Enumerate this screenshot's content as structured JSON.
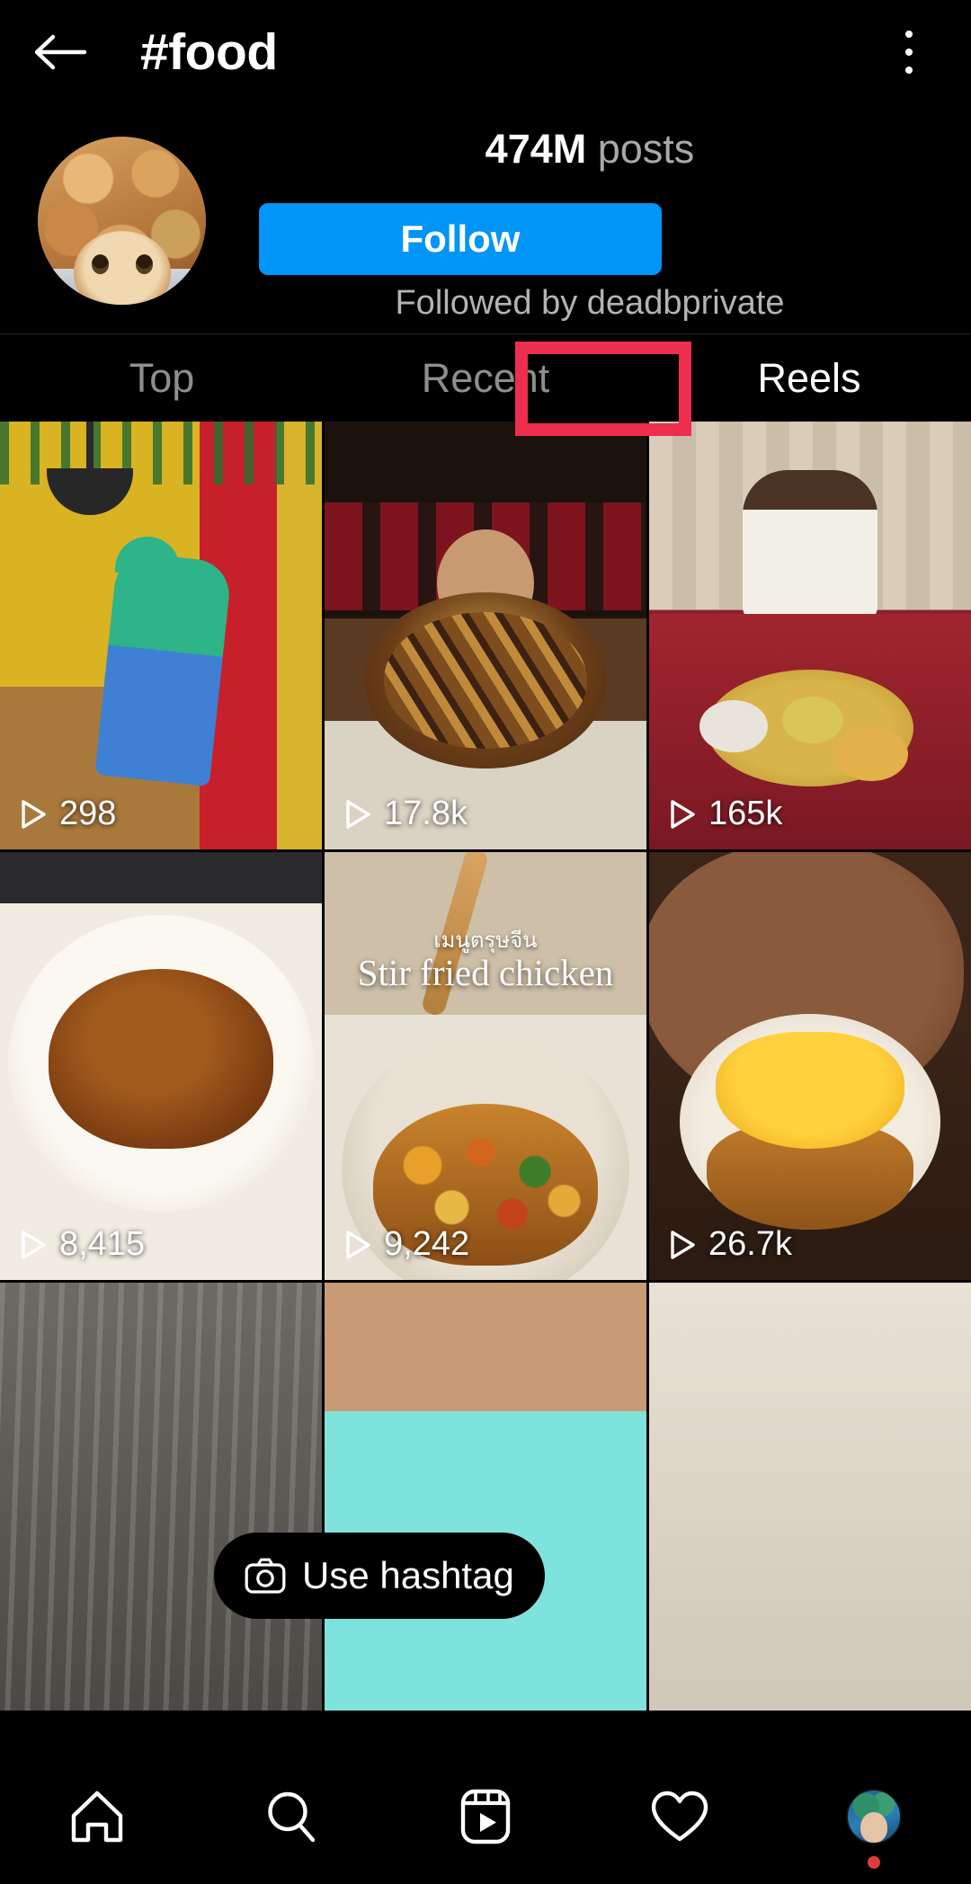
{
  "appbar": {
    "back_icon": "arrow-left-icon",
    "title": "#food",
    "menu_icon": "kebab-menu-icon"
  },
  "header": {
    "avatar_alt": "hashtag-avatar",
    "posts_number": "474M",
    "posts_label": " posts",
    "follow_label": "Follow",
    "followed_by": "Followed by deadbprivate"
  },
  "tabs": {
    "items": [
      {
        "label": "Top",
        "active": false
      },
      {
        "label": "Recent",
        "active": false
      },
      {
        "label": "Reels",
        "active": true
      }
    ],
    "highlight_color": "#ed2e4f"
  },
  "grid": {
    "tiles": [
      {
        "views": "298",
        "play_icon": "play-triangle-icon",
        "alt": "reel-cleaning-restaurant"
      },
      {
        "views": "17.8k",
        "play_icon": "play-triangle-icon",
        "alt": "reel-giant-meat-platter"
      },
      {
        "views": "165k",
        "play_icon": "play-triangle-icon",
        "alt": "reel-indian-thali"
      },
      {
        "views": "8,415",
        "play_icon": "play-triangle-icon",
        "alt": "reel-curry-bowl"
      },
      {
        "views": "9,242",
        "play_icon": "play-triangle-icon",
        "alt": "reel-stir-fried-chicken"
      },
      {
        "views": "26.7k",
        "play_icon": "play-triangle-icon",
        "alt": "reel-cheese-sandwich"
      }
    ],
    "partial_row": [
      {
        "alt": "reel-partial-1"
      },
      {
        "alt": "reel-partial-2"
      },
      {
        "alt": "reel-partial-3"
      }
    ],
    "captions": {
      "tile5_thai": "เมนูตรุษจีน",
      "tile5_english": "Stir fried chicken"
    }
  },
  "use_hashtag": {
    "icon": "camera-icon",
    "label": "Use hashtag"
  },
  "bottomnav": {
    "items": [
      {
        "name": "home-icon",
        "label": "Home"
      },
      {
        "name": "search-icon",
        "label": "Search"
      },
      {
        "name": "reels-icon",
        "label": "Reels"
      },
      {
        "name": "heart-icon",
        "label": "Activity"
      },
      {
        "name": "profile-avatar",
        "label": "Profile"
      }
    ],
    "notification_dot_color": "#e03c3c"
  }
}
